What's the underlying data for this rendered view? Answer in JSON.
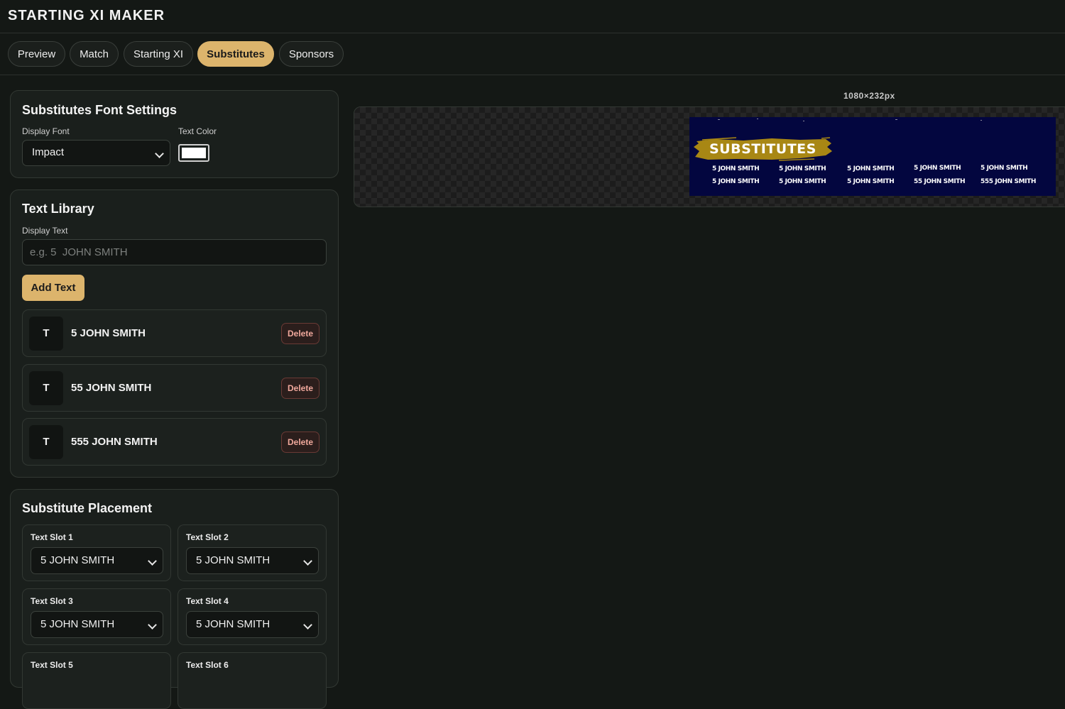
{
  "app": {
    "title": "STARTING XI MAKER"
  },
  "tabs": [
    {
      "label": "Preview",
      "active": false
    },
    {
      "label": "Match",
      "active": false
    },
    {
      "label": "Starting XI",
      "active": false
    },
    {
      "label": "Substitutes",
      "active": true
    },
    {
      "label": "Sponsors",
      "active": false
    }
  ],
  "font_settings": {
    "title": "Substitutes Font Settings",
    "display_font_label": "Display Font",
    "display_font_value": "Impact",
    "text_color_label": "Text Color",
    "text_color_value": "#ffffff"
  },
  "text_library": {
    "title": "Text Library",
    "display_text_label": "Display Text",
    "display_text_placeholder": "e.g. 5  JOHN SMITH",
    "add_button": "Add Text",
    "items": [
      {
        "icon": "T",
        "text": "5 JOHN SMITH",
        "delete_label": "Delete"
      },
      {
        "icon": "T",
        "text": "55 JOHN SMITH",
        "delete_label": "Delete"
      },
      {
        "icon": "T",
        "text": "555 JOHN SMITH",
        "delete_label": "Delete"
      }
    ]
  },
  "placement": {
    "title": "Substitute Placement",
    "slots": [
      {
        "label": "Text Slot 1",
        "value": "5 JOHN SMITH"
      },
      {
        "label": "Text Slot 2",
        "value": "5 JOHN SMITH"
      },
      {
        "label": "Text Slot 3",
        "value": "5 JOHN SMITH"
      },
      {
        "label": "Text Slot 4",
        "value": "5 JOHN SMITH"
      },
      {
        "label": "Text Slot 5",
        "value": ""
      },
      {
        "label": "Text Slot 6",
        "value": ""
      }
    ]
  },
  "preview": {
    "size_label": "1080×232px",
    "banner": {
      "title": "SUBSTITUTES",
      "background": "#03063f",
      "brush_color": "#a88714",
      "rows": [
        [
          "5 JOHN SMITH",
          "5 JOHN SMITH",
          "5 JOHN SMITH",
          "5 JOHN SMITH",
          "5 JOHN SMITH"
        ],
        [
          "5 JOHN SMITH",
          "5 JOHN SMITH",
          "5 JOHN SMITH",
          "55 JOHN SMITH",
          "555 JOHN SMITH"
        ]
      ]
    }
  },
  "colors": {
    "accent": "#dcb46c",
    "background": "#141815",
    "panel": "#1a1f1c",
    "delete_text": "#f0a89c"
  }
}
